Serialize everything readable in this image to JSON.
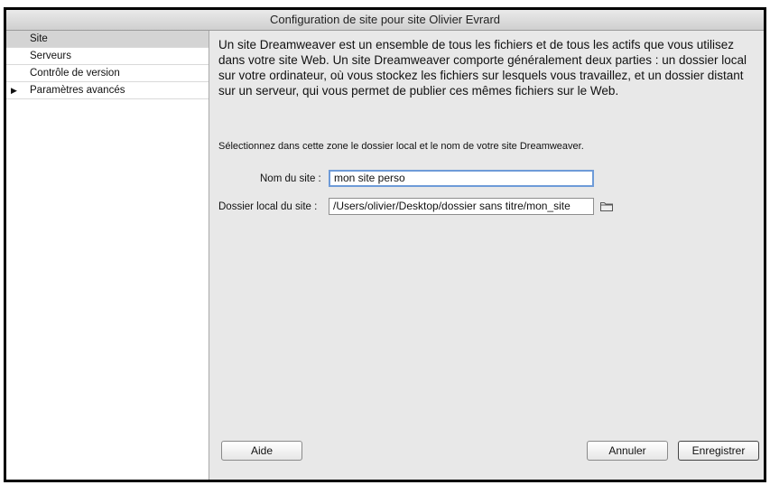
{
  "window": {
    "title": "Configuration de site pour site Olivier Evrard"
  },
  "sidebar": {
    "items": [
      {
        "label": "Site"
      },
      {
        "label": "Serveurs"
      },
      {
        "label": "Contrôle de version"
      },
      {
        "label": "Paramètres avancés",
        "expander": "▶"
      }
    ]
  },
  "main": {
    "description": "Un site Dreamweaver est un ensemble de tous les fichiers et de tous les actifs que vous utilisez dans votre site Web. Un site Dreamweaver comporte généralement deux parties : un dossier local sur votre ordinateur, où vous stockez les fichiers sur lesquels vous travaillez, et un dossier distant sur un serveur, qui vous permet de publier ces mêmes fichiers sur le Web.",
    "instruction": "Sélectionnez dans cette zone le dossier local et le nom de votre site Dreamweaver.",
    "site_name": {
      "label": "Nom du site :",
      "value": "mon site perso"
    },
    "local_folder": {
      "label": "Dossier local du site :",
      "value": "/Users/olivier/Desktop/dossier sans titre/mon_site",
      "icon": "folder-icon"
    }
  },
  "buttons": {
    "help": "Aide",
    "cancel": "Annuler",
    "save": "Enregistrer"
  }
}
